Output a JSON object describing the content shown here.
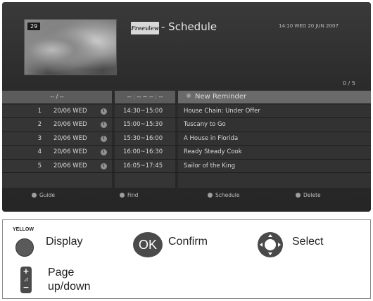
{
  "screen": {
    "channel_number": "29",
    "logo_text": "Freeview",
    "title": "- Schedule",
    "datetime": "14:10 WED 20 JUN 2007",
    "page_indicator": "0 / 5"
  },
  "list": {
    "header": {
      "date": "-- / --",
      "time": "-- : -- ~ -- : --",
      "title": "New Reminder"
    },
    "rows": [
      {
        "num": "1",
        "date": "20/06 WED",
        "time": "14:30~15:00",
        "title": "House Chain: Under Offer"
      },
      {
        "num": "2",
        "date": "20/06 WED",
        "time": "15:00~15:30",
        "title": "Tuscany to Go"
      },
      {
        "num": "3",
        "date": "20/06 WED",
        "time": "15:30~16:00",
        "title": "A House in Florida"
      },
      {
        "num": "4",
        "date": "20/06 WED",
        "time": "16:00~16:30",
        "title": "Ready Steady Cook"
      },
      {
        "num": "5",
        "date": "20/06 WED",
        "time": "16:05~17:45",
        "title": "Sailor of the King"
      }
    ]
  },
  "footer": {
    "guide": "Guide",
    "find": "Find",
    "schedule": "Schedule",
    "delete": "Delete"
  },
  "legend": {
    "yellow_key": "YELLOW",
    "display": "Display",
    "ok_key": "OK",
    "confirm": "Confirm",
    "select": "Select",
    "page_line1": "Page",
    "page_line2": "up/down",
    "page_plus": "+",
    "page_minus": "−",
    "page_vol": "◿"
  }
}
